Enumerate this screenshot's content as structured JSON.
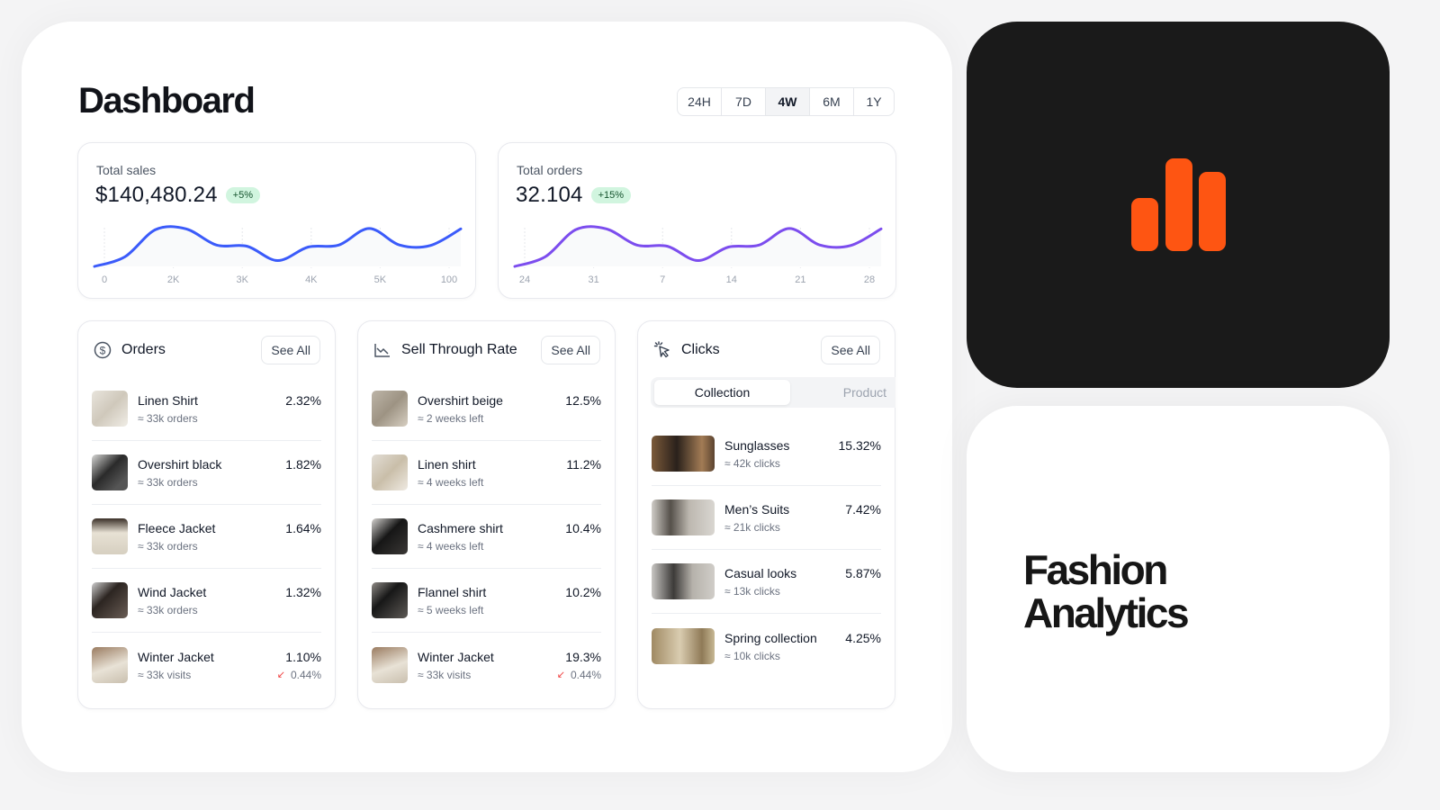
{
  "dashboard": {
    "title": "Dashboard",
    "ranges": [
      {
        "label": "24H",
        "active": false
      },
      {
        "label": "7D",
        "active": false
      },
      {
        "label": "4W",
        "active": true
      },
      {
        "label": "6M",
        "active": false
      },
      {
        "label": "1Y",
        "active": false
      }
    ]
  },
  "total_sales": {
    "label": "Total sales",
    "value": "$140,480.24",
    "badge": "+5%"
  },
  "total_orders": {
    "label": "Total orders",
    "value": "32.104",
    "badge": "+15%"
  },
  "chart_data": [
    {
      "type": "line",
      "title": "Total sales",
      "color": "#3b5bfa",
      "x_tick_labels": [
        "0",
        "2K",
        "3K",
        "4K",
        "5K",
        "100"
      ],
      "grid": true,
      "series": [
        {
          "name": "Total sales",
          "values": [
            0.0,
            0.25,
            0.95,
            0.97,
            0.55,
            0.52,
            0.15,
            0.5,
            0.55,
            0.98,
            0.55,
            0.54,
            0.97
          ]
        }
      ],
      "ylim": [
        0,
        1
      ]
    },
    {
      "type": "line",
      "title": "Total orders",
      "color": "#7c4dee",
      "x_tick_labels": [
        "24",
        "31",
        "7",
        "14",
        "21",
        "28"
      ],
      "grid": true,
      "series": [
        {
          "name": "Total orders",
          "values": [
            0.0,
            0.25,
            0.95,
            0.97,
            0.55,
            0.52,
            0.15,
            0.5,
            0.55,
            0.98,
            0.55,
            0.54,
            0.97
          ]
        }
      ],
      "ylim": [
        0,
        1
      ]
    }
  ],
  "orders": {
    "title": "Orders",
    "see_all": "See All",
    "items": [
      {
        "name": "Linen Shirt",
        "sub": "≈ 33k orders",
        "value": "2.32%"
      },
      {
        "name": "Overshirt black",
        "sub": "≈ 33k orders",
        "value": "1.82%"
      },
      {
        "name": "Fleece Jacket",
        "sub": "≈ 33k orders",
        "value": "1.64%"
      },
      {
        "name": "Wind Jacket",
        "sub": "≈ 33k orders",
        "value": "1.32%"
      },
      {
        "name": "Winter Jacket",
        "sub": "≈ 33k visits",
        "value": "1.10%",
        "change": "0.44%"
      }
    ]
  },
  "sell_through": {
    "title": "Sell Through Rate",
    "see_all": "See All",
    "items": [
      {
        "name": "Overshirt beige",
        "sub": "≈ 2 weeks left",
        "value": "12.5%"
      },
      {
        "name": "Linen shirt",
        "sub": "≈ 4 weeks left",
        "value": "11.2%"
      },
      {
        "name": "Cashmere shirt",
        "sub": "≈ 4 weeks left",
        "value": "10.4%"
      },
      {
        "name": "Flannel shirt",
        "sub": "≈ 5 weeks left",
        "value": "10.2%"
      },
      {
        "name": "Winter Jacket",
        "sub": "≈ 33k visits",
        "value": "19.3%",
        "change": "0.44%"
      }
    ]
  },
  "clicks": {
    "title": "Clicks",
    "see_all": "See All",
    "tabs": [
      {
        "label": "Collection",
        "active": true
      },
      {
        "label": "Product",
        "active": false
      }
    ],
    "items": [
      {
        "name": "Sunglasses",
        "sub": "≈ 42k clicks",
        "value": "15.32%"
      },
      {
        "name": "Men’s Suits",
        "sub": "≈ 21k clicks",
        "value": "7.42%"
      },
      {
        "name": "Casual looks",
        "sub": "≈ 13k clicks",
        "value": "5.87%"
      },
      {
        "name": "Spring collection",
        "sub": "≈ 10k clicks",
        "value": "4.25%"
      }
    ]
  },
  "brand": {
    "title_line1": "Fashion",
    "title_line2": "Analytics",
    "logo_icon": "bar-chart-icon",
    "logo_color": "#fe5512"
  }
}
